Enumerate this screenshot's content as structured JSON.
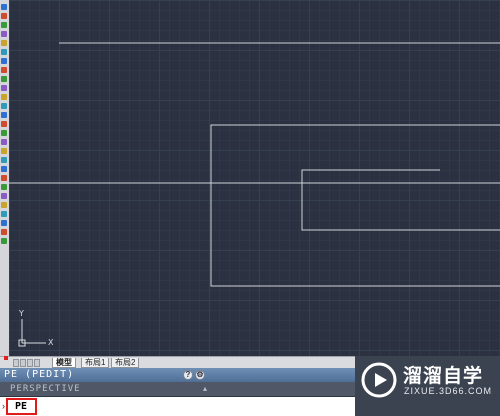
{
  "layout_tabs": [
    {
      "label": "模型",
      "active": true
    },
    {
      "label": "布局1",
      "active": false
    },
    {
      "label": "布局2",
      "active": false
    }
  ],
  "command_window": {
    "title": "PE (PEDIT)",
    "help_icon": "question-icon",
    "settings_icon": "gear-icon",
    "prompt": "PERSPECTIVE",
    "input_value": "PE"
  },
  "ucs": {
    "x_label": "X",
    "y_label": "Y"
  },
  "watermark": {
    "name": "溜溜自学",
    "url": "ZIXUE.3D66.COM",
    "logo_icon": "play-icon"
  },
  "colors": {
    "canvas_bg": "#2b3140",
    "line_color": "#d0d3d8",
    "highlight": "#e01b1b",
    "header_blue": "#5f80a8"
  }
}
